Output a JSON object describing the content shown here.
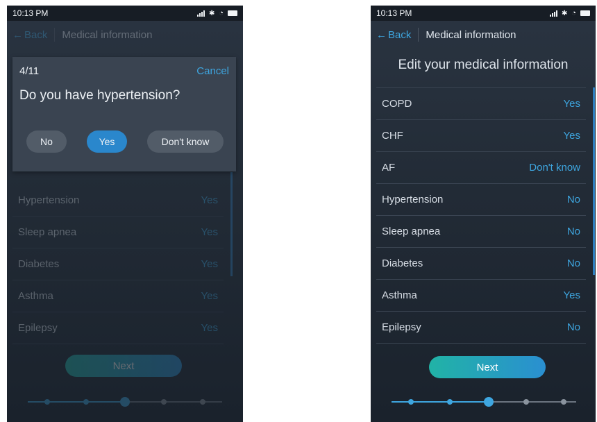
{
  "status": {
    "time": "10:13 PM"
  },
  "nav": {
    "back_label": "Back",
    "title": "Medical information"
  },
  "dialog": {
    "progress": "4/11",
    "cancel_label": "Cancel",
    "question": "Do you have hypertension?",
    "options": [
      "No",
      "Yes",
      "Don't know"
    ],
    "selected_option": "Yes"
  },
  "left_list": [
    {
      "label": "Hypertension",
      "value": "Yes"
    },
    {
      "label": "Sleep apnea",
      "value": "Yes"
    },
    {
      "label": "Diabetes",
      "value": "Yes"
    },
    {
      "label": "Asthma",
      "value": "Yes"
    },
    {
      "label": "Epilepsy",
      "value": "Yes"
    }
  ],
  "right": {
    "heading": "Edit your medical information",
    "list": [
      {
        "label": "COPD",
        "value": "Yes"
      },
      {
        "label": "CHF",
        "value": "Yes"
      },
      {
        "label": "AF",
        "value": "Don't know"
      },
      {
        "label": "Hypertension",
        "value": "No"
      },
      {
        "label": "Sleep apnea",
        "value": "No"
      },
      {
        "label": "Diabetes",
        "value": "No"
      },
      {
        "label": "Asthma",
        "value": "Yes"
      },
      {
        "label": "Epilepsy",
        "value": "No"
      }
    ]
  },
  "next_label": "Next",
  "stepper": {
    "total_steps": 5,
    "current_step": 3
  },
  "colors": {
    "accent": "#3ea6e0",
    "background": "#222b36",
    "next_gradient_start": "#21b3a6",
    "next_gradient_end": "#2a8fd1"
  }
}
